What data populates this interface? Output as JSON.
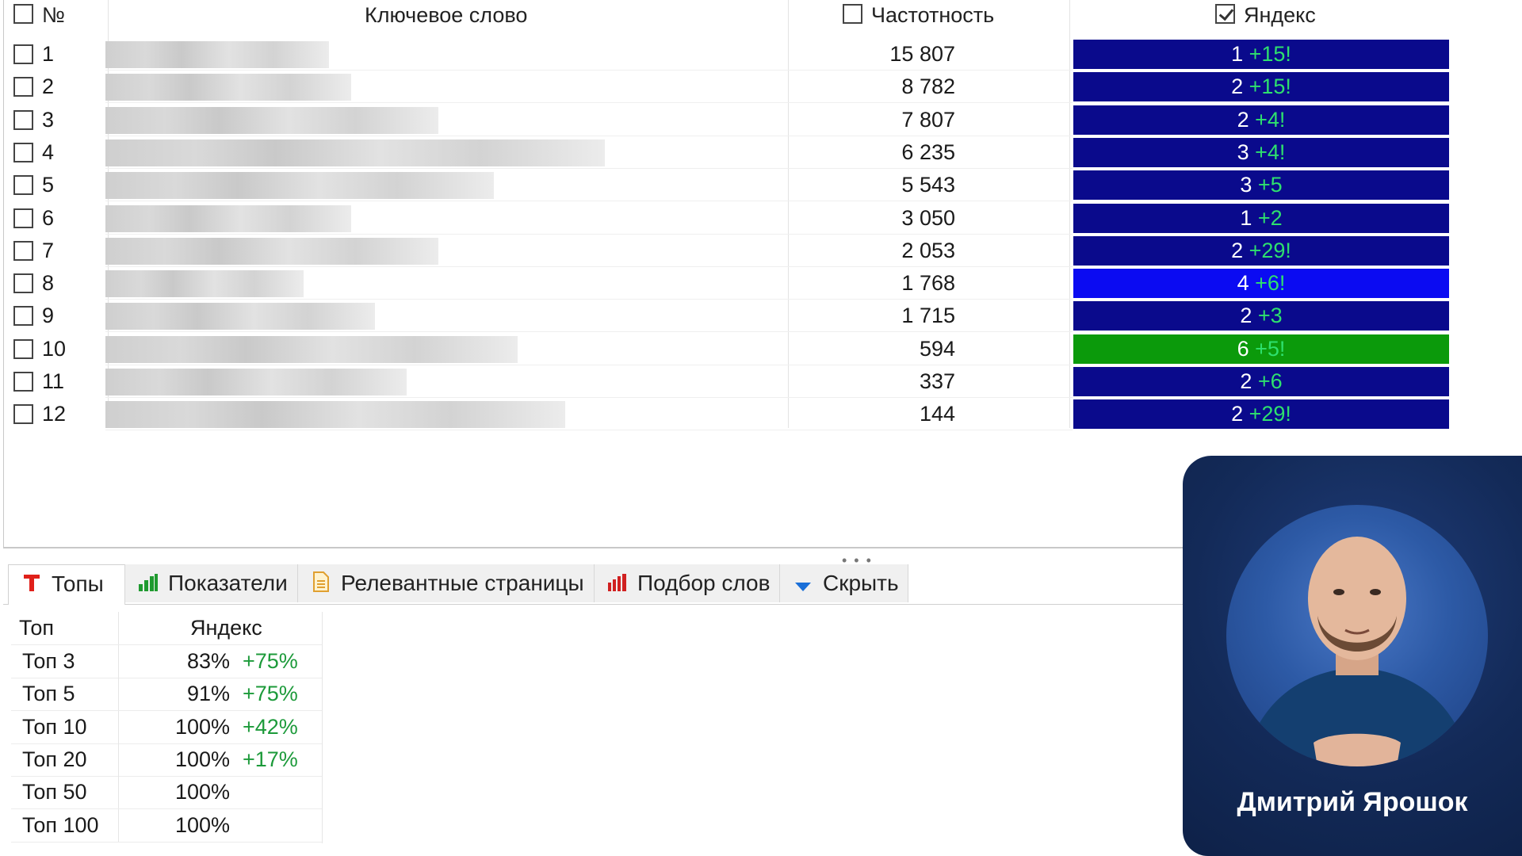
{
  "grid": {
    "header": {
      "num": "№",
      "keyword": "Ключевое слово",
      "frequency": "Частотность",
      "yandex": "Яндекс",
      "yandex_checked": true
    },
    "rows": [
      {
        "num": "1",
        "freq": "15 807",
        "pos": "1",
        "delta": "+15!",
        "color": "#0a0a8c"
      },
      {
        "num": "2",
        "freq": "8 782",
        "pos": "2",
        "delta": "+15!",
        "color": "#0a0a8c"
      },
      {
        "num": "3",
        "freq": "7 807",
        "pos": "2",
        "delta": "+4!",
        "color": "#0a0a8c"
      },
      {
        "num": "4",
        "freq": "6 235",
        "pos": "3",
        "delta": "+4!",
        "color": "#0a0a8c"
      },
      {
        "num": "5",
        "freq": "5 543",
        "pos": "3",
        "delta": "+5",
        "color": "#0a0a8c"
      },
      {
        "num": "6",
        "freq": "3 050",
        "pos": "1",
        "delta": "+2",
        "color": "#0a0a8c"
      },
      {
        "num": "7",
        "freq": "2 053",
        "pos": "2",
        "delta": "+29!",
        "color": "#0a0a8c"
      },
      {
        "num": "8",
        "freq": "1 768",
        "pos": "4",
        "delta": "+6!",
        "color": "#0b0bf2"
      },
      {
        "num": "9",
        "freq": "1 715",
        "pos": "2",
        "delta": "+3",
        "color": "#0a0a8c"
      },
      {
        "num": "10",
        "freq": "594",
        "pos": "6",
        "delta": "+5!",
        "color": "#0b9a0b"
      },
      {
        "num": "11",
        "freq": "337",
        "pos": "2",
        "delta": "+6",
        "color": "#0a0a8c"
      },
      {
        "num": "12",
        "freq": "144",
        "pos": "2",
        "delta": "+29!",
        "color": "#0a0a8c"
      }
    ]
  },
  "tabs": [
    {
      "label": "Топы",
      "icon": "red-t-icon",
      "active": true
    },
    {
      "label": "Показатели",
      "icon": "bar-chart-green-icon",
      "active": false
    },
    {
      "label": "Релевантные страницы",
      "icon": "document-icon",
      "active": false
    },
    {
      "label": "Подбор слов",
      "icon": "bar-chart-red-icon",
      "active": false
    },
    {
      "label": "Скрыть",
      "icon": "chevron-down-icon",
      "active": false
    }
  ],
  "tops": {
    "header": {
      "top": "Топ",
      "yandex": "Яндекс"
    },
    "rows": [
      {
        "label": "Топ 3",
        "pct": "83%",
        "change": "+75%"
      },
      {
        "label": "Топ 5",
        "pct": "91%",
        "change": "+75%"
      },
      {
        "label": "Топ 10",
        "pct": "100%",
        "change": "+42%"
      },
      {
        "label": "Топ 20",
        "pct": "100%",
        "change": "+17%"
      },
      {
        "label": "Топ 50",
        "pct": "100%",
        "change": ""
      },
      {
        "label": "Топ 100",
        "pct": "100%",
        "change": ""
      }
    ]
  },
  "author": {
    "name": "Дмитрий Ярошок"
  },
  "colors": {
    "accent_green": "#1c9a3a",
    "card_bg": "#132a58"
  }
}
